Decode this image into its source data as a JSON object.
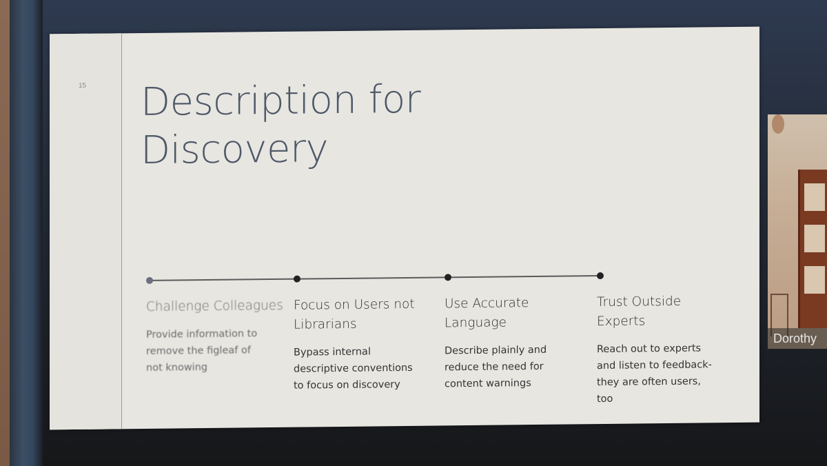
{
  "slide": {
    "number": "15",
    "title_line1": "Description for",
    "title_line2": "Discovery",
    "columns": [
      {
        "title": "Challenge Colleagues",
        "body": "Provide information to remove the figleaf of not knowing"
      },
      {
        "title": "Focus on Users not Librarians",
        "body": "Bypass internal descriptive conventions to focus on discovery"
      },
      {
        "title": "Use Accurate Language",
        "body": "Describe plainly and reduce the need for content warnings"
      },
      {
        "title": "Trust Outside Experts",
        "body": "Reach out to experts and listen to feedback- they are often users, too"
      }
    ]
  },
  "video": {
    "participant_name": "Dorothy"
  }
}
